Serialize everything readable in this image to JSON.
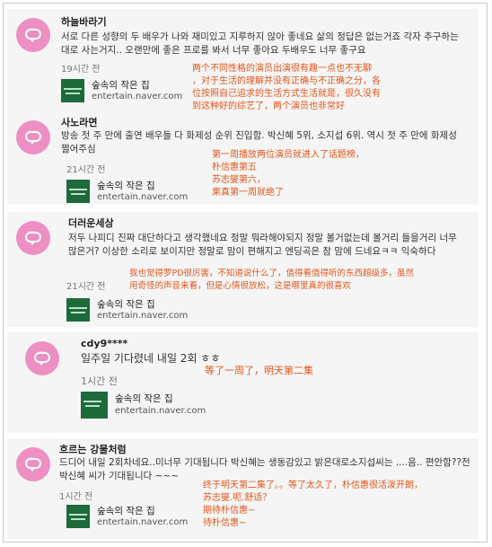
{
  "comments": [
    {
      "nickname": "하늘바라기",
      "text": "서로 다른 성향의 두 배우가 나와 재미있고 지루하지 않아 좋네요 삶의 정답은 없는거죠 각자 추구하는대로 사는거지.. 오랜만에 좋은 프로를 봐서 너무 좋아요 두배우도 너무 좋구요",
      "time": "19시간 전",
      "source_title": "숲속의 작은 집",
      "source_domain": "entertain.naver.com",
      "translation": "两个不同性格的演员出演很有趣一点也不无聊\n，对于生活的理解并没有正确与不正确之分，各\n位按照自己追求的生活方式生活就是，很久没有\n到这种好的综艺了，两个演员也非常好"
    },
    {
      "nickname": "사노라면",
      "text": "방송 첫 주 만에 출연 배우들 다 화제성 순위 진입함. 박신혜 5위, 소지섭 6위. 역시 첫 주 만에 화제성 쩔어주심",
      "time": "21시간 전",
      "source_title": "숲속의 작은 집",
      "source_domain": "entertain.naver.com",
      "translation": "第一周播放两位演员就进入了话题榜，\n朴信惠第五\n苏志燮第六，\n果真第一周就绝了"
    },
    {
      "nickname": "더러운세상",
      "text": "저두 나피디 진짜 대단하다고 생각했네요 정말 뭐라해야되지 정말 볼거없는데 볼거리 들을거리 너무 많은거? 이상한 소리로 보이지만 정말로 맘이 편해지고 엔딩곡은 참 맘에 드네요ㅋㅋ 익숙하다",
      "time": "21시간 전",
      "source_title": "숲속의 작은 집",
      "source_domain": "entertain.naver.com",
      "translation": "我也觉得罗PD很厉害，不知道说什么了，值得看值得听的东西超级多，虽然\n用奇怪的声音来看，但是心情很放松，这是哪里真的很喜欢"
    },
    {
      "nickname": "cdy9****",
      "text": "일주일 기다렸네 내일 2회 ㅎㅎ",
      "time": "1시간 전",
      "source_title": "숲속의 작은 집",
      "source_domain": "entertain.naver.com",
      "translation": "等了一周了，明天第二集"
    },
    {
      "nickname": "흐르는 강물처럼",
      "text": "드디어 내일 2회차네요..미너무 기대됩니다 박신혜는 생동감있고 밝은대로소지섭씨는 ....음.. 편안함??전 박신혜 씨가 기대됩니다 ~~~",
      "time": "1시간 전",
      "source_title": "숲속의 작은 집",
      "source_domain": "entertain.naver.com",
      "translation": "终于明天第二集了。。等了太久了，朴信惠很活泼开朗，\n苏志燮.呃.舒适？\n期待朴信惠~\n待朴信惠~"
    }
  ]
}
